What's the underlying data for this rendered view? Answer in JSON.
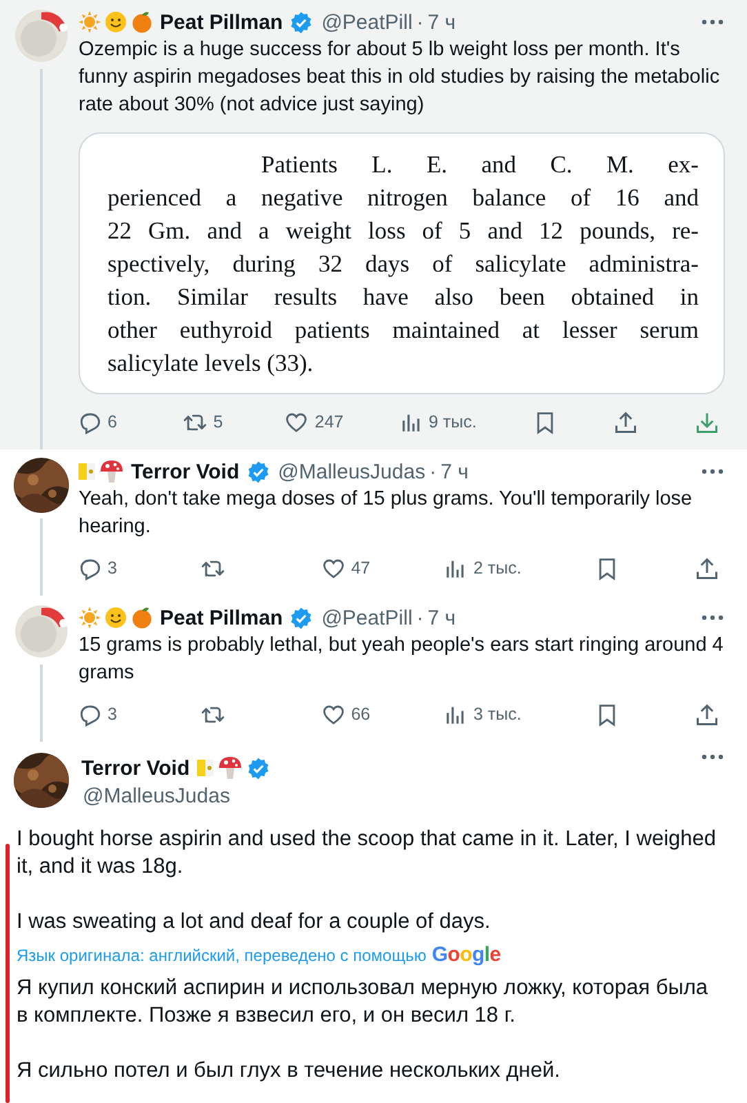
{
  "tweets": [
    {
      "kind": "reply",
      "hovered": true,
      "author": {
        "name": "Peat Pillman",
        "handle": "@PeatPill",
        "separator": "·",
        "time": "7 ч"
      },
      "text": "Ozempic is a huge success for about 5 lb weight loss per month. It's funny aspirin megadoses beat this in old studies by raising the metabolic rate about 30% (not advice just saying)",
      "document": {
        "lines": [
          "Patients L. E. and C. M. ex-",
          "perienced a negative nitrogen balance of 16 and",
          "22 Gm. and a weight loss of 5 and 12 pounds, re-",
          "spectively, during 32 days of salicylate administra-",
          "tion.  Similar results have also been obtained in",
          "other euthyroid patients maintained at lesser serum",
          "salicylate levels (33)."
        ]
      },
      "actions": [
        {
          "kind": "reply",
          "count": "6"
        },
        {
          "kind": "repost",
          "count": "5"
        },
        {
          "kind": "like",
          "count": "247"
        },
        {
          "kind": "views",
          "count": "9 тыс."
        },
        {
          "kind": "bookmark"
        },
        {
          "kind": "share"
        },
        {
          "kind": "download"
        }
      ]
    },
    {
      "kind": "reply",
      "hovered": false,
      "author": {
        "name": "Terror Void",
        "handle": "@MalleusJudas",
        "separator": "·",
        "time": "7 ч"
      },
      "text": "Yeah, don't take mega doses of 15 plus grams.  You'll temporarily lose hearing.",
      "actions": [
        {
          "kind": "reply",
          "count": "3"
        },
        {
          "kind": "repost"
        },
        {
          "kind": "like",
          "count": "47"
        },
        {
          "kind": "views",
          "count": "2 тыс."
        },
        {
          "kind": "bookmark"
        },
        {
          "kind": "share"
        }
      ]
    },
    {
      "kind": "reply",
      "hovered": false,
      "author": {
        "name": "Peat Pillman",
        "handle": "@PeatPill",
        "separator": "·",
        "time": "7 ч"
      },
      "text": "15 grams is probably lethal, but yeah people's ears start ringing around 4 grams",
      "actions": [
        {
          "kind": "reply",
          "count": "3"
        },
        {
          "kind": "repost"
        },
        {
          "kind": "like",
          "count": "66"
        },
        {
          "kind": "views",
          "count": "3 тыс."
        },
        {
          "kind": "bookmark"
        },
        {
          "kind": "share"
        }
      ]
    },
    {
      "kind": "focused",
      "hovered": false,
      "author": {
        "name": "Terror Void",
        "handle": "@MalleusJudas"
      },
      "paragraphs": [
        "I bought horse aspirin and used the scoop that came in it. Later, I weighed it, and it was 18g.",
        "I was sweating a lot and deaf for a couple of days."
      ],
      "translation": {
        "note": "Язык оригинала: английский, переведено с помощью",
        "service": "Google",
        "paragraphs": [
          "Я купил конский аспирин и использовал мерную ложку, которая была в комплекте. Позже я взвесил его, и он весил 18 г.",
          "Я сильно потел и был глух в течение нескольких дней."
        ]
      }
    }
  ]
}
